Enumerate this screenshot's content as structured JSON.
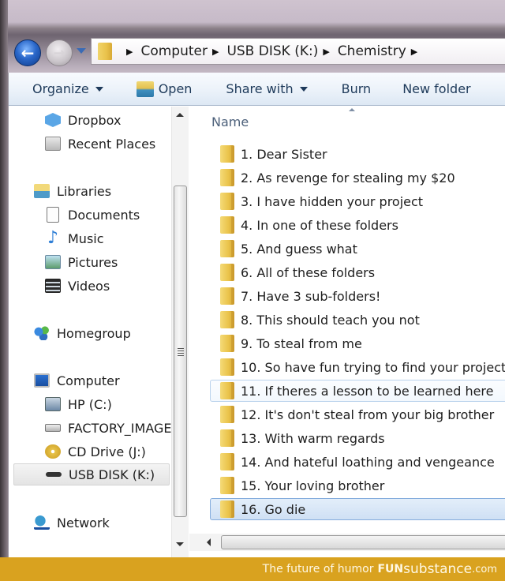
{
  "navigation": {
    "back_icon": "arrow-left",
    "forward_icon": "arrow-right",
    "breadcrumb": [
      "Computer",
      "USB DISK (K:)",
      "Chemistry"
    ]
  },
  "toolbar": {
    "organize": "Organize",
    "open": "Open",
    "share_with": "Share with",
    "burn": "Burn",
    "new_folder": "New folder"
  },
  "sidebar": {
    "items": [
      {
        "label": "Dropbox",
        "icon": "dropbox-icon"
      },
      {
        "label": "Recent Places",
        "icon": "recent-places-icon"
      },
      {
        "label": "Libraries",
        "icon": "libraries-icon"
      },
      {
        "label": "Documents",
        "icon": "documents-icon"
      },
      {
        "label": "Music",
        "icon": "music-icon"
      },
      {
        "label": "Pictures",
        "icon": "pictures-icon"
      },
      {
        "label": "Videos",
        "icon": "videos-icon"
      },
      {
        "label": "Homegroup",
        "icon": "homegroup-icon"
      },
      {
        "label": "Computer",
        "icon": "computer-icon"
      },
      {
        "label": "HP (C:)",
        "icon": "drive-icon"
      },
      {
        "label": "FACTORY_IMAGE",
        "icon": "drive-icon"
      },
      {
        "label": "CD Drive (J:)",
        "icon": "cd-drive-icon"
      },
      {
        "label": "USB DISK (K:)",
        "icon": "usb-drive-icon",
        "selected": true
      },
      {
        "label": "Network",
        "icon": "network-icon"
      }
    ]
  },
  "file_list": {
    "column_header": "Name",
    "folders": [
      "1. Dear Sister",
      "2. As revenge for stealing my $20",
      "3. I have hidden your project",
      "4. In one of these folders",
      "5. And guess what",
      "6. All of these folders",
      "7. Have 3 sub-folders!",
      "8. This should teach you not",
      "9. To steal from me",
      "10. So have fun trying to find your project",
      "11. If theres a lesson to be learned here",
      "12. It's don't steal from your big brother",
      "13. With warm regards",
      "14. And hateful loathing and vengeance",
      "15. Your loving brother",
      "16. Go die"
    ],
    "hovered_index": 10,
    "selected_index": 15
  },
  "banner": {
    "tagline": "The future of humor",
    "brand_fun": "FUN",
    "brand_substance": "substance",
    "brand_tld": ".com",
    "color": "#d9a21f"
  }
}
